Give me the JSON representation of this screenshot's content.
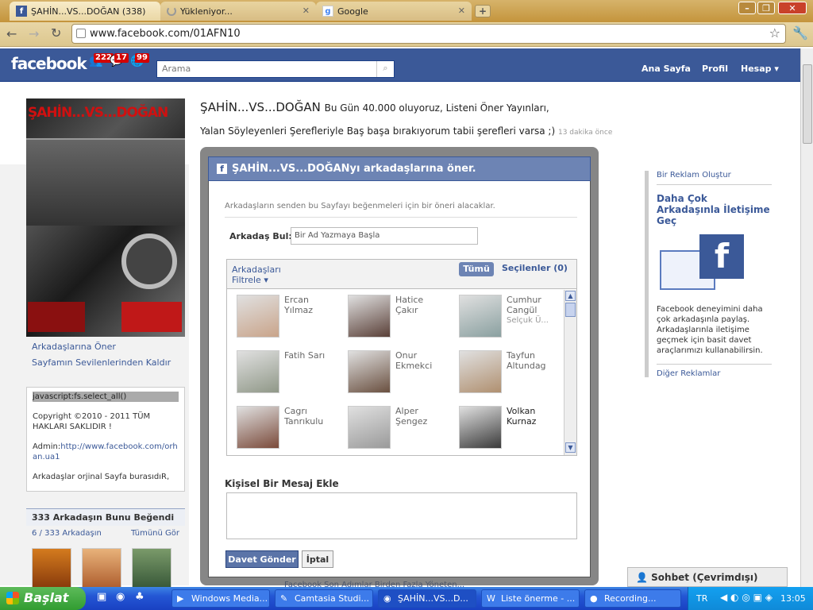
{
  "browser": {
    "tabs": [
      {
        "title": "ŞAHİN...VS...DOĞAN (338)"
      },
      {
        "title": "Yükleniyor..."
      },
      {
        "title": "Google"
      }
    ],
    "new_tab": "+",
    "url": "www.facebook.com/01AFN10"
  },
  "fb": {
    "logo": "facebook",
    "badges": [
      "222",
      "17",
      "99"
    ],
    "search_placeholder": "Arama",
    "nav": [
      "Ana Sayfa",
      "Profil",
      "Hesap ▾"
    ]
  },
  "page": {
    "name": "ŞAHİN...VS...DOĞAN",
    "status1": "Bu Gün 40.000 oluyoruz, Listeni Öner Yayınları,",
    "status2": "Yalan Söyleyenleri Şerefleriyle Baş başa bırakıyorum tabii şerefleri varsa ;)",
    "status_time": "13 dakika önce",
    "pic_text": "ŞAHİN...VS...DOĞAN",
    "links": [
      "Arkadaşlarına Öner",
      "Sayfamın Sevilenlerinden Kaldır"
    ],
    "info": {
      "code": "javascript:fs.select_all()",
      "copyright": "Copyright ©2010 - 2011 TÜM HAKLARI SAKLIDIR !",
      "admin_label": "Admin:",
      "admin_link": "http://www.facebook.com/orhan.ua1",
      "note": "Arkadaşlar orjinal Sayfa burasıdıR,"
    },
    "likes": {
      "title": "333 Arkadaşın Bunu Beğendi",
      "count": "6 / 333 Arkadaşın",
      "see_all": "Tümünü Gör"
    },
    "bottom_text": "Facebook Son Adımlar Birden Fazla Yöneten..."
  },
  "ads": {
    "create": "Bir Reklam Oluştur",
    "title": "Daha Çok Arkadaşınla İletişime Geç",
    "body": "Facebook deneyimini daha çok arkadaşınla paylaş. Arkadaşlarınla iletişime geçmek için basit davet araçlarımızı kullanabilirsin.",
    "more": "Diğer Reklamlar"
  },
  "dialog": {
    "title": "ŞAHİN...VS...DOĞANyı arkadaşlarına öner.",
    "intro": "Arkadaşların senden bu Sayfayı beğenmeleri için bir öneri alacaklar.",
    "find_label": "Arkadaş Bul:",
    "find_placeholder": "Bir Ad Yazmaya Başla",
    "filter_label": "Arkadaşları",
    "filter_sub": "Filtrele ▾",
    "all_btn": "Tümü",
    "selected_btn": "Seçilenler (0)",
    "friends": [
      {
        "name": "Ercan Yılmaz",
        "sub": ""
      },
      {
        "name": "Hatice Çakır",
        "sub": ""
      },
      {
        "name": "Cumhur Cangül",
        "sub": "Selçuk Ü..."
      },
      {
        "name": "Fatih Sarı",
        "sub": ""
      },
      {
        "name": "Onur Ekmekci",
        "sub": ""
      },
      {
        "name": "Tayfun Altundag",
        "sub": ""
      },
      {
        "name": "Cagrı Tanrıkulu",
        "sub": ""
      },
      {
        "name": "Alper Şengez",
        "sub": ""
      },
      {
        "name": "Volkan Kurnaz",
        "sub": ""
      }
    ],
    "msg_label": "Kişisel Bir Mesaj Ekle",
    "send": "Davet Gönder",
    "cancel": "İptal"
  },
  "chat": {
    "label": "Sohbet (Çevrimdışı)"
  },
  "taskbar": {
    "start": "Başlat",
    "tasks": [
      "Windows Media...",
      "Camtasia Studi...",
      "ŞAHİN...VS...D...",
      "Liste önerme - ...",
      "Recording..."
    ],
    "lang": "TR",
    "time": "13:05"
  },
  "colors": {
    "fb_blue": "#3b5998",
    "dialog_head": "#6d84b4",
    "badge_red": "#d40000"
  }
}
